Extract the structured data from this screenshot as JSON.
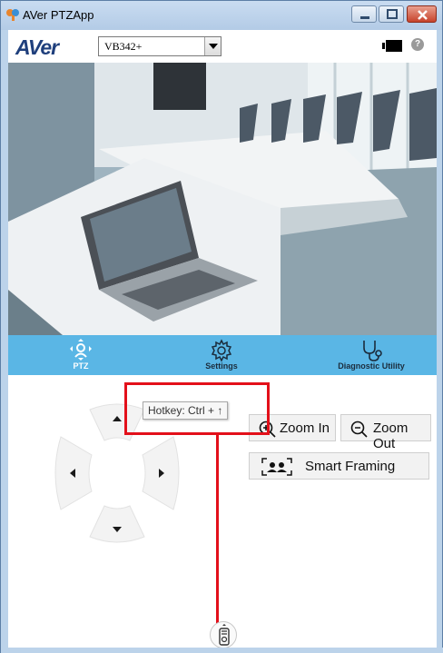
{
  "window": {
    "title": "AVer PTZApp"
  },
  "header": {
    "logo_text": "AVer",
    "camera_selected": "VB342+"
  },
  "tabs": [
    {
      "label": "PTZ",
      "icon": "ptz-icon",
      "active": true
    },
    {
      "label": "Settings",
      "icon": "gear-icon",
      "active": false
    },
    {
      "label": "Diagnostic Utility",
      "icon": "stethoscope-icon",
      "active": false
    }
  ],
  "ptz": {
    "zoom_in_label": "Zoom In",
    "zoom_out_label": "Zoom Out",
    "smart_framing_label": "Smart Framing",
    "tooltip": "Hotkey: Ctrl + ↑"
  },
  "colors": {
    "accent": "#5ab6e5",
    "highlight": "#e3101a",
    "logo": "#1f3f7c"
  }
}
